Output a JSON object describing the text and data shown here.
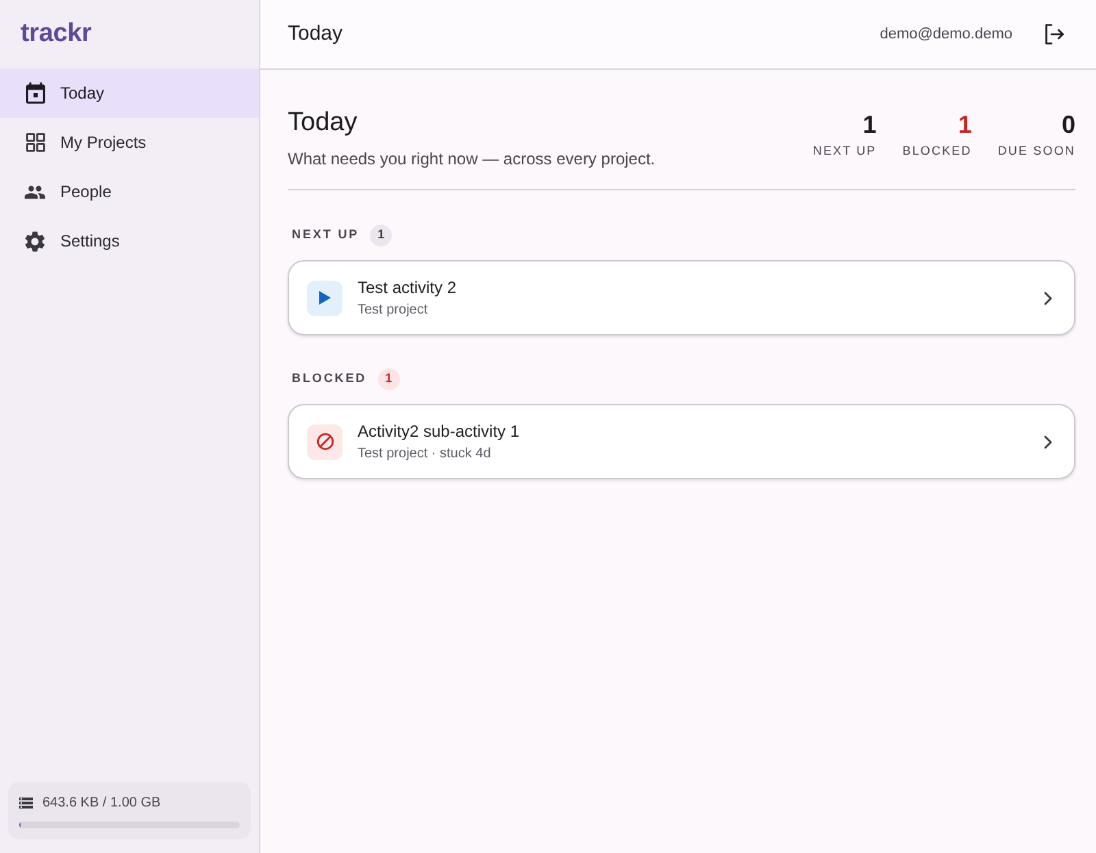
{
  "sidebar": {
    "logo": "trackr",
    "nav": [
      {
        "label": "Today",
        "selected": true
      },
      {
        "label": "My Projects",
        "selected": false
      },
      {
        "label": "People",
        "selected": false
      },
      {
        "label": "Settings",
        "selected": false
      }
    ],
    "storage": {
      "text": "643.6 KB / 1.00 GB",
      "level": 0.0006
    }
  },
  "header": {
    "title": "Today",
    "user_email": "demo@demo.demo"
  },
  "page": {
    "title": "Today",
    "subtitle": "What needs you right now — across every project.",
    "stats": [
      {
        "value": "1",
        "label": "NEXT UP",
        "color": "#1d1b20"
      },
      {
        "value": "1",
        "label": "BLOCKED",
        "color": "#c62828"
      },
      {
        "value": "0",
        "label": "DUE SOON",
        "color": "#1d1b20"
      }
    ]
  },
  "sections": [
    {
      "kind": "next_up",
      "title": "NEXT UP",
      "count": "1",
      "items": [
        {
          "title": "Test activity 2",
          "meta": "Test project"
        }
      ]
    },
    {
      "kind": "blocked",
      "title": "BLOCKED",
      "count": "1",
      "items": [
        {
          "title": "Activity2 sub-activity 1",
          "meta": "Test project · stuck 4d"
        }
      ]
    }
  ]
}
